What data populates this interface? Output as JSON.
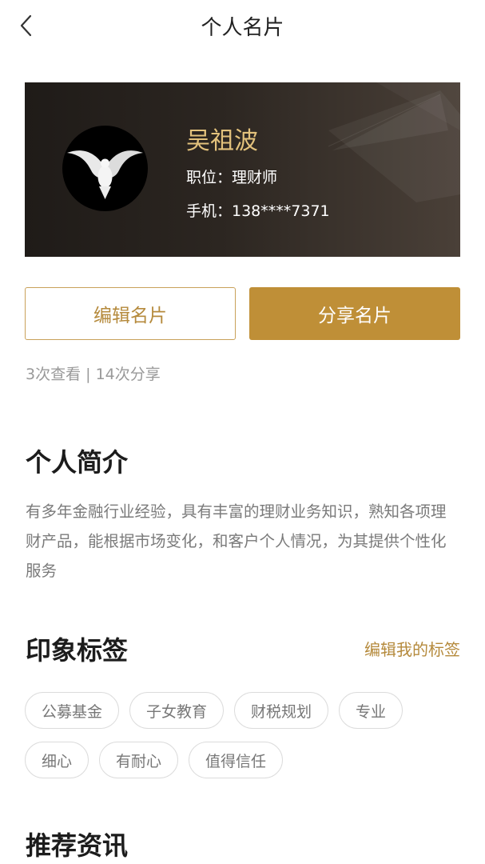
{
  "header": {
    "title": "个人名片"
  },
  "card": {
    "name": "吴祖波",
    "position": "职位：理财师",
    "phone": "手机：138****7371"
  },
  "actions": {
    "edit_label": "编辑名片",
    "share_label": "分享名片"
  },
  "stats": "3次查看 | 14次分享",
  "intro": {
    "title": "个人简介",
    "text": "有多年金融行业经验，具有丰富的理财业务知识，熟知各项理财产品，能根据市场变化，和客户个人情况，为其提供个性化服务"
  },
  "tags": {
    "title": "印象标签",
    "edit_label": "编辑我的标签",
    "items": [
      "公募基金",
      "子女教育",
      "财税规划",
      "专业",
      "细心",
      "有耐心",
      "值得信任"
    ]
  },
  "news": {
    "title": "推荐资讯"
  },
  "colors": {
    "accent": "#bf8f37",
    "card_name": "#e3c27c",
    "card_bg": "#2c2621"
  },
  "icons": {
    "back": "chevron-left-icon",
    "avatar": "dove-icon"
  }
}
